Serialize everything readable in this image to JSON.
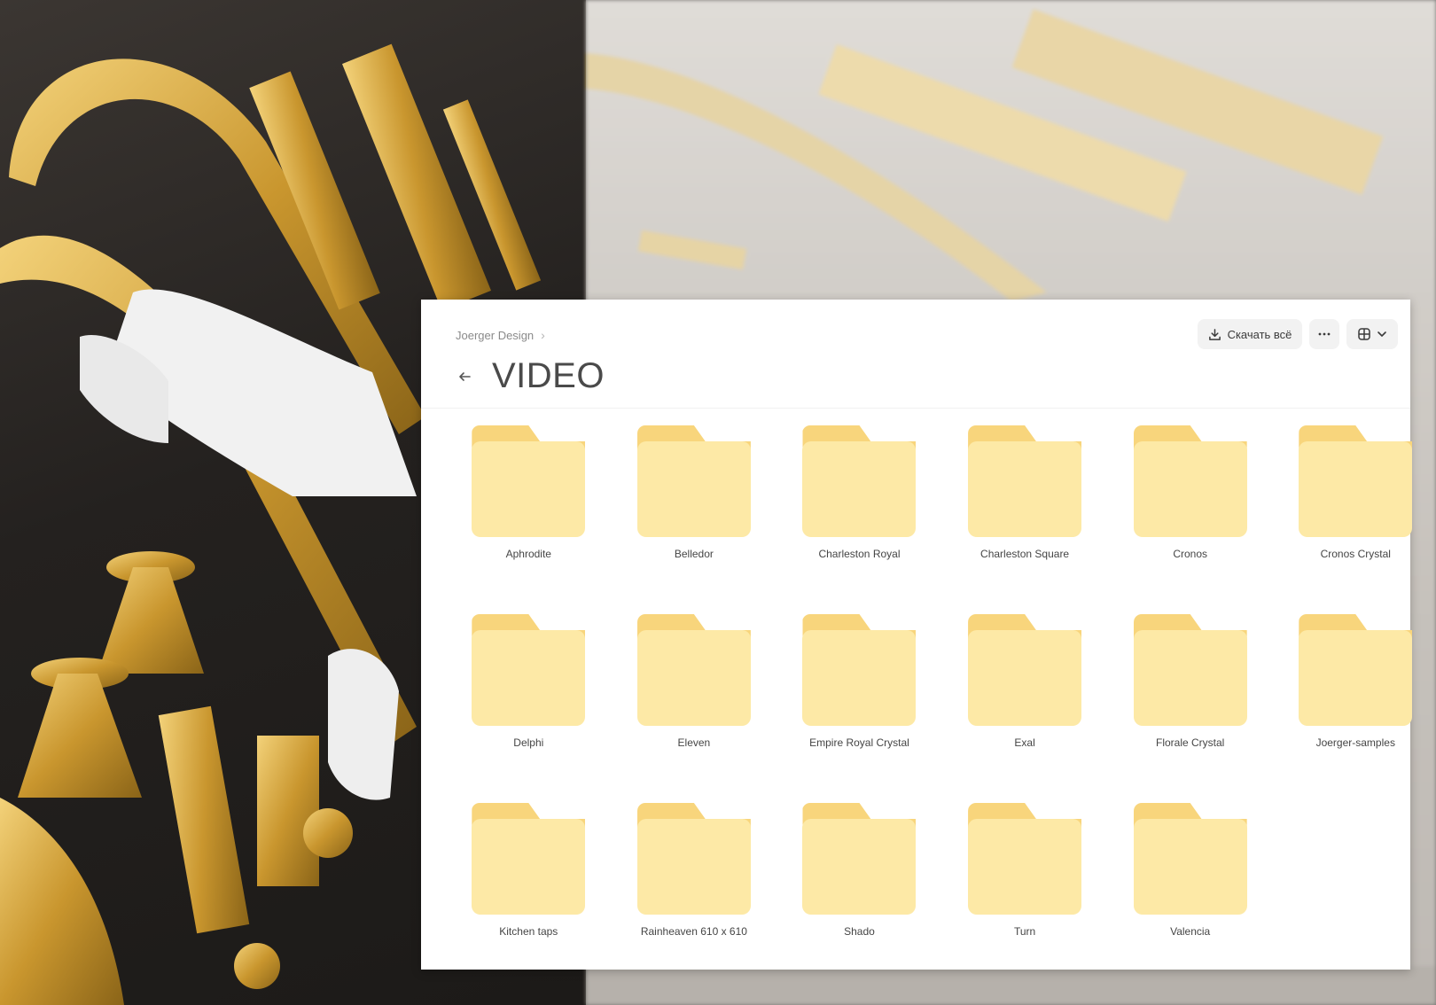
{
  "breadcrumb": {
    "parent": "Joerger Design"
  },
  "toolbar": {
    "download_label": "Скачать всё"
  },
  "title": "VIDEO",
  "folders": [
    {
      "name": "Aphrodite"
    },
    {
      "name": "Belledor"
    },
    {
      "name": "Charleston Royal"
    },
    {
      "name": "Charleston Square"
    },
    {
      "name": "Cronos"
    },
    {
      "name": "Cronos Crystal"
    },
    {
      "name": "Delphi"
    },
    {
      "name": "Eleven"
    },
    {
      "name": "Empire Royal Crystal"
    },
    {
      "name": "Exal"
    },
    {
      "name": "Florale Crystal"
    },
    {
      "name": "Joerger-samples"
    },
    {
      "name": "Kitchen taps"
    },
    {
      "name": "Rainheaven 610 x 610"
    },
    {
      "name": "Shado"
    },
    {
      "name": "Turn"
    },
    {
      "name": "Valencia"
    }
  ],
  "colors": {
    "folder_body": "#fde9a6",
    "folder_tab": "#f8d57c",
    "button_bg": "#f2f2f2"
  },
  "icons": {
    "download": "download-icon",
    "more": "more-icon",
    "view": "grid-view-icon",
    "back": "back-arrow-icon"
  }
}
